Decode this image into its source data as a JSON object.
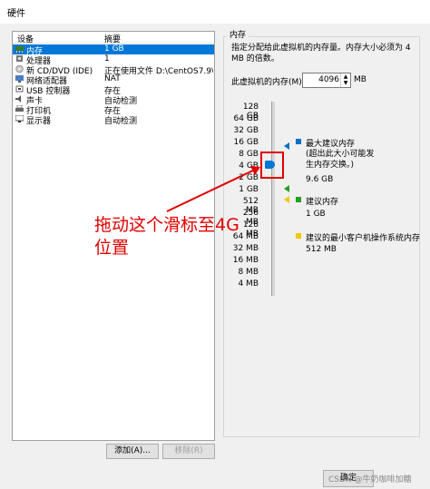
{
  "window": {
    "title": "硬件"
  },
  "devices": {
    "headers": {
      "device": "设备",
      "summary": "摘要"
    },
    "rows": [
      {
        "name": "内存",
        "summary": "1 GB",
        "icon": "memory-icon"
      },
      {
        "name": "处理器",
        "summary": "1",
        "icon": "cpu-icon"
      },
      {
        "name": "新 CD/DVD (IDE)",
        "summary": "正在使用文件 D:\\CentOS7.9\\",
        "icon": "cd-icon"
      },
      {
        "name": "网络适配器",
        "summary": "NAT",
        "icon": "network-icon"
      },
      {
        "name": "USB 控制器",
        "summary": "存在",
        "icon": "usb-icon"
      },
      {
        "name": "声卡",
        "summary": "自动检测",
        "icon": "sound-icon"
      },
      {
        "name": "打印机",
        "summary": "存在",
        "icon": "printer-icon"
      },
      {
        "name": "显示器",
        "summary": "自动检测",
        "icon": "monitor-icon"
      }
    ],
    "add_button": "添加(A)...",
    "remove_button": "移除(R)"
  },
  "memory": {
    "group_title": "内存",
    "description": "指定分配给此虚拟机的内存量。内存大小必须为 4 MB 的倍数。",
    "field_label": "此虚拟机的内存(M):",
    "value": "4096",
    "unit": "MB",
    "ticks": [
      "128 GB",
      "64 GB",
      "32 GB",
      "16 GB",
      "8 GB",
      "4 GB",
      "2 GB",
      "1 GB",
      "512 MB",
      "256 MB",
      "128 MB",
      "64 MB",
      "32 MB",
      "16 MB",
      "8 MB",
      "4 MB"
    ],
    "legend": {
      "max_recommended": "最大建议内存",
      "max_note": "(超出此大小可能发生内存交换。)",
      "max_value": "9.6 GB",
      "recommended": "建议内存",
      "recommended_value": "1 GB",
      "min_recommended": "建议的最小客户机操作系统内存",
      "min_value": "512 MB"
    },
    "colors": {
      "max": "#0070c0",
      "recommended": "#22a020",
      "min": "#f0c800"
    }
  },
  "annotation": {
    "line1": "拖动这个滑标至4G",
    "line2": "位置"
  },
  "footer": {
    "ok_button": "确定",
    "watermark": "CSDN @牛奶咖啡加糖"
  }
}
